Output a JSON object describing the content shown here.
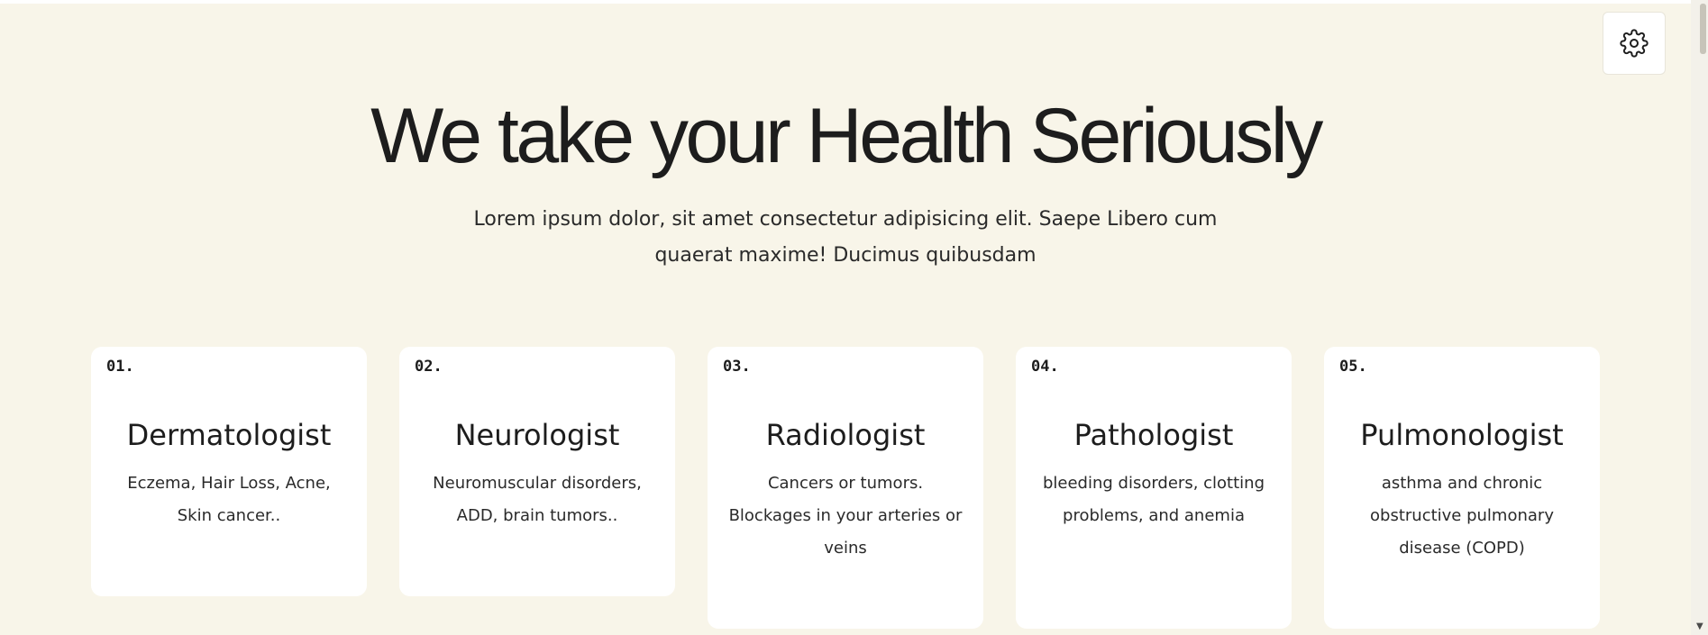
{
  "hero": {
    "title": "We take your Health Seriously",
    "subtitle": "Lorem ipsum dolor, sit amet consectetur adipisicing elit. Saepe Libero cum quaerat maxime! Ducimus quibusdam"
  },
  "settings": {
    "icon": "gear-icon"
  },
  "cards": [
    {
      "number": "01.",
      "title": "Dermatologist",
      "description": "Eczema, Hair Loss, Acne, Skin cancer.."
    },
    {
      "number": "02.",
      "title": "Neurologist",
      "description": "Neuromuscular disorders, ADD, brain tumors.."
    },
    {
      "number": "03.",
      "title": "Radiologist",
      "description": "Cancers or tumors. Blockages in your arteries or veins"
    },
    {
      "number": "04.",
      "title": "Pathologist",
      "description": "bleeding disorders, clotting problems, and anemia"
    },
    {
      "number": "05.",
      "title": "Pulmonologist",
      "description": "asthma and chronic obstructive pulmonary disease (COPD)"
    }
  ],
  "colors": {
    "background": "#f8f5e9",
    "card": "#ffffff",
    "text": "#1d1d1d"
  }
}
